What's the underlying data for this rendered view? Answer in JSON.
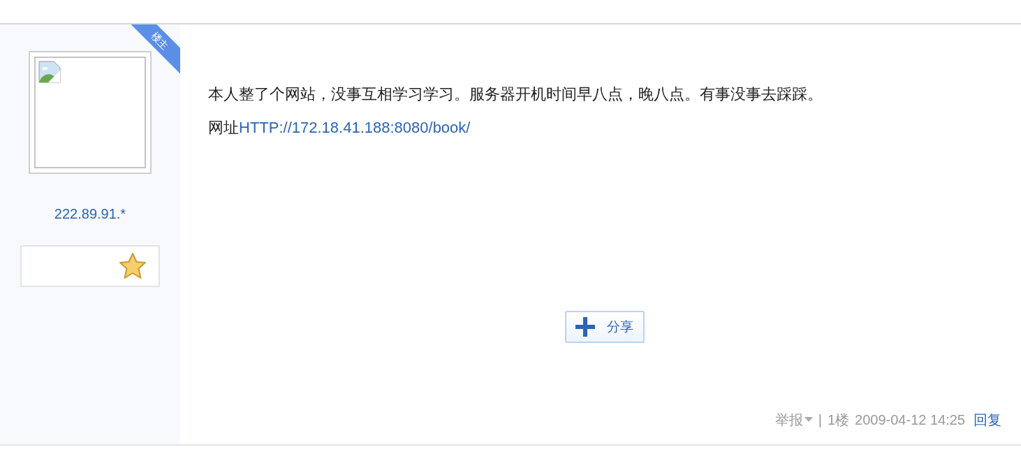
{
  "post": {
    "author_badge": "楼主",
    "author": {
      "name": "222.89.91.*"
    },
    "content": {
      "text": "本人整了个网站，没事互相学习学习。服务器开机时间早八点，晚八点。有事没事去踩踩。",
      "prefix": "网址",
      "link": "HTTP://172.18.41.188:8080/book/"
    },
    "share_button": "分享",
    "footer": {
      "report": "举报",
      "separator": "|",
      "floor": "1楼",
      "time": "2009-04-12 14:25",
      "reply": "回复"
    }
  }
}
